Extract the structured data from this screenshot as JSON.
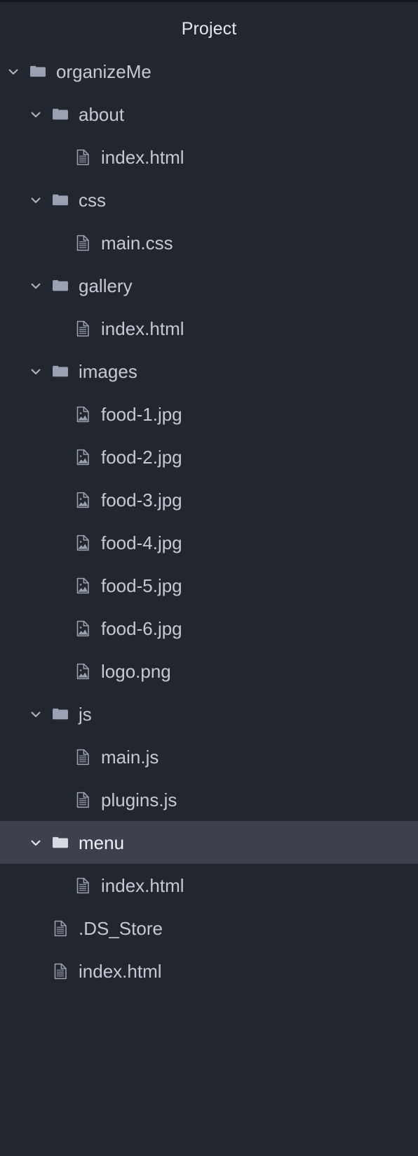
{
  "panel": {
    "title": "Project",
    "background": "#22262e",
    "selection_color": "#3c414d",
    "text_color": "#c4cad5",
    "folder_icon_color": "#99a1b3"
  },
  "tree": {
    "items": [
      {
        "label": "organizeMe",
        "type": "folder",
        "icon": "folder-icon",
        "depth": 0,
        "expanded": true,
        "chevron": "chevron-down-icon",
        "selected": false
      },
      {
        "label": "about",
        "type": "folder",
        "icon": "folder-icon",
        "depth": 1,
        "expanded": true,
        "chevron": "chevron-down-icon",
        "selected": false
      },
      {
        "label": "index.html",
        "type": "file",
        "icon": "file-icon",
        "depth": 2,
        "expanded": false,
        "chevron": "",
        "selected": false
      },
      {
        "label": "css",
        "type": "folder",
        "icon": "folder-icon",
        "depth": 1,
        "expanded": true,
        "chevron": "chevron-down-icon",
        "selected": false
      },
      {
        "label": "main.css",
        "type": "file",
        "icon": "file-icon",
        "depth": 2,
        "expanded": false,
        "chevron": "",
        "selected": false
      },
      {
        "label": "gallery",
        "type": "folder",
        "icon": "folder-icon",
        "depth": 1,
        "expanded": true,
        "chevron": "chevron-down-icon",
        "selected": false
      },
      {
        "label": "index.html",
        "type": "file",
        "icon": "file-icon",
        "depth": 2,
        "expanded": false,
        "chevron": "",
        "selected": false
      },
      {
        "label": "images",
        "type": "folder",
        "icon": "folder-icon",
        "depth": 1,
        "expanded": true,
        "chevron": "chevron-down-icon",
        "selected": false
      },
      {
        "label": "food-1.jpg",
        "type": "image",
        "icon": "image-file-icon",
        "depth": 2,
        "expanded": false,
        "chevron": "",
        "selected": false
      },
      {
        "label": "food-2.jpg",
        "type": "image",
        "icon": "image-file-icon",
        "depth": 2,
        "expanded": false,
        "chevron": "",
        "selected": false
      },
      {
        "label": "food-3.jpg",
        "type": "image",
        "icon": "image-file-icon",
        "depth": 2,
        "expanded": false,
        "chevron": "",
        "selected": false
      },
      {
        "label": "food-4.jpg",
        "type": "image",
        "icon": "image-file-icon",
        "depth": 2,
        "expanded": false,
        "chevron": "",
        "selected": false
      },
      {
        "label": "food-5.jpg",
        "type": "image",
        "icon": "image-file-icon",
        "depth": 2,
        "expanded": false,
        "chevron": "",
        "selected": false
      },
      {
        "label": "food-6.jpg",
        "type": "image",
        "icon": "image-file-icon",
        "depth": 2,
        "expanded": false,
        "chevron": "",
        "selected": false
      },
      {
        "label": "logo.png",
        "type": "image",
        "icon": "image-file-icon",
        "depth": 2,
        "expanded": false,
        "chevron": "",
        "selected": false
      },
      {
        "label": "js",
        "type": "folder",
        "icon": "folder-icon",
        "depth": 1,
        "expanded": true,
        "chevron": "chevron-down-icon",
        "selected": false
      },
      {
        "label": "main.js",
        "type": "file",
        "icon": "file-icon",
        "depth": 2,
        "expanded": false,
        "chevron": "",
        "selected": false
      },
      {
        "label": "plugins.js",
        "type": "file",
        "icon": "file-icon",
        "depth": 2,
        "expanded": false,
        "chevron": "",
        "selected": false
      },
      {
        "label": "menu",
        "type": "folder",
        "icon": "folder-icon",
        "depth": 1,
        "expanded": true,
        "chevron": "chevron-down-icon",
        "selected": true
      },
      {
        "label": "index.html",
        "type": "file",
        "icon": "file-icon",
        "depth": 2,
        "expanded": false,
        "chevron": "",
        "selected": false
      },
      {
        "label": ".DS_Store",
        "type": "file",
        "icon": "file-icon",
        "depth": 1,
        "expanded": false,
        "chevron": "",
        "selected": false
      },
      {
        "label": "index.html",
        "type": "file",
        "icon": "file-icon",
        "depth": 1,
        "expanded": false,
        "chevron": "",
        "selected": false
      }
    ]
  }
}
